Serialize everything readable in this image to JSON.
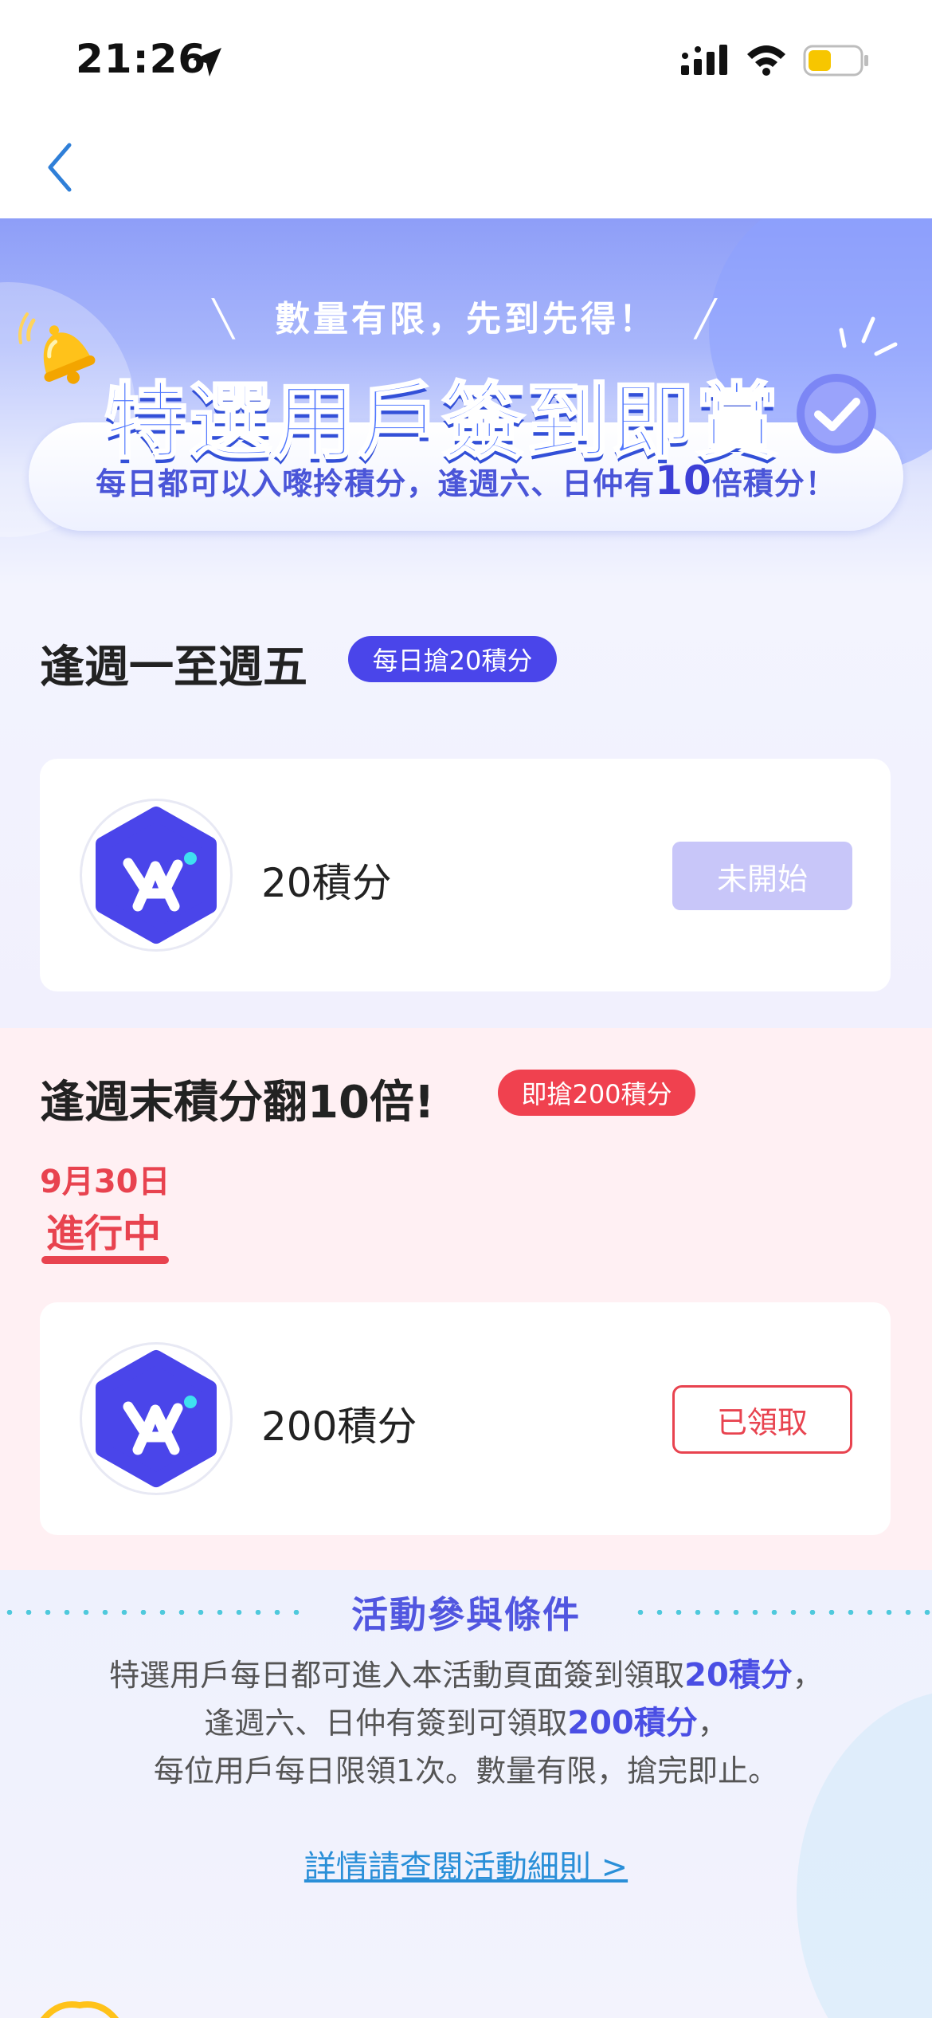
{
  "status_bar": {
    "time": "21:26",
    "icons": [
      "location-arrow-icon",
      "cellular-signal-icon",
      "wifi-icon",
      "battery-icon"
    ],
    "battery_color": "#f7c600"
  },
  "nav": {
    "back_icon": "chevron-left-icon"
  },
  "hero": {
    "slogan": "數量有限，先到先得！",
    "slash_left": "╲",
    "slash_right": "╱",
    "title": "特選用戶簽到即賞",
    "subtitle_part1": "每日都可以入嚟拎積分，逢週六、日仲有",
    "subtitle_highlight": "10",
    "subtitle_part2": "倍積分！",
    "icons": [
      "bell-icon",
      "check-circle-icon",
      "sparkle-icon"
    ]
  },
  "weekday": {
    "heading": "逢週一至週五",
    "badge": "每日搶20積分",
    "card": {
      "logo_icon": "app-logo-icon",
      "amount": "20積分",
      "button_label": "未開始"
    }
  },
  "weekend": {
    "heading": "逢週末積分翻10倍!",
    "badge": "即搶200積分",
    "date": "9月30日",
    "status": "進行中",
    "card": {
      "logo_icon": "app-logo-icon",
      "amount": "200積分",
      "button_label": "已領取"
    }
  },
  "conditions": {
    "title": "活動參與條件",
    "line1_pre": "特選用戶每日都可進入本活動頁面簽到領取",
    "line1_hl": "20積分",
    "line1_post": "，",
    "line2_pre": "逢週六、日仲有簽到可領取",
    "line2_hl": "200積分",
    "line2_post": "，",
    "line3": "每位用戶每日限領1次。數量有限，搶完即止。",
    "link": "詳情請查閱活動細則 >"
  },
  "colors": {
    "brand_blue": "#4a45ea",
    "accent_red": "#e8434f",
    "disabled_button": "#c8c6f9",
    "link_blue": "#2a8fd8"
  }
}
